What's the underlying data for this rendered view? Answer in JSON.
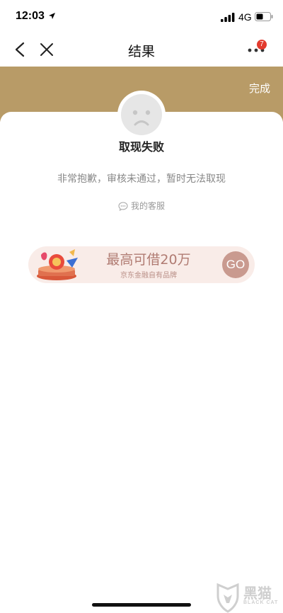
{
  "status_bar": {
    "time": "12:03",
    "network": "4G",
    "location_icon": "location-arrow-icon",
    "signal_icon": "signal-icon",
    "battery_icon": "battery-icon"
  },
  "nav": {
    "title": "结果",
    "back_icon": "back-icon",
    "close_icon": "close-icon",
    "more_icon": "more-icon",
    "badge_count": "7"
  },
  "header": {
    "done_label": "完成",
    "band_color": "#b89b67"
  },
  "result": {
    "status_icon": "sad-face-icon",
    "title": "取现失败",
    "description": "非常抱歉，审核未通过，暂时无法取现",
    "service_link": "我的客服",
    "service_icon": "chat-bubble-icon"
  },
  "promo": {
    "title": "最高可借20万",
    "subtitle": "京东金融自有品牌",
    "button_label": "GO"
  },
  "watermark": {
    "text": "黑猫",
    "subtext": "BLACK CAT"
  },
  "colors": {
    "accent": "#b89b67",
    "badge": "#e33b2e",
    "promo_bg": "#f9ece8",
    "go_button": "#c99a8f"
  }
}
